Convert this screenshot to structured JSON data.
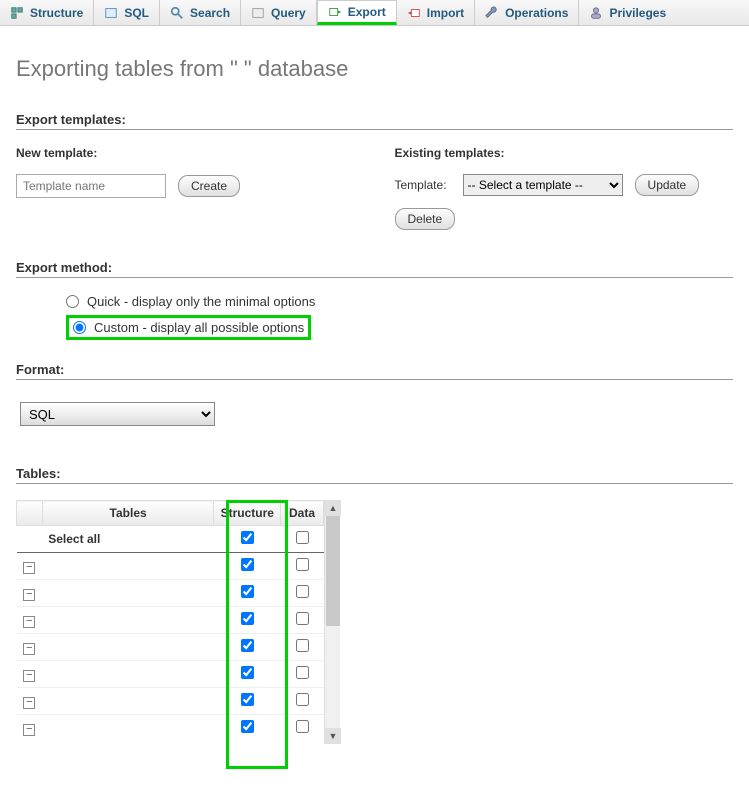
{
  "tabs": {
    "structure": "Structure",
    "sql": "SQL",
    "search": "Search",
    "query": "Query",
    "export": "Export",
    "import": "Import",
    "operations": "Operations",
    "privileges": "Privileges"
  },
  "heading": "Exporting tables from \"                    \" database",
  "sections": {
    "templates": "Export templates:",
    "method": "Export method:",
    "format": "Format:",
    "tables": "Tables:"
  },
  "templates": {
    "new_label": "New template:",
    "existing_label": "Existing templates:",
    "name_placeholder": "Template name",
    "create": "Create",
    "template_word": "Template:",
    "select_option": "-- Select a template --",
    "update": "Update",
    "delete": "Delete"
  },
  "method": {
    "quick": "Quick - display only the minimal options",
    "custom": "Custom - display all possible options"
  },
  "format_value": "SQL",
  "tables_table": {
    "col_tables": "Tables",
    "col_structure": "Structure",
    "col_data": "Data",
    "select_all": "Select all",
    "rows": [
      {
        "name": "",
        "structure": true,
        "data": false
      },
      {
        "name": "",
        "structure": true,
        "data": false
      },
      {
        "name": "",
        "structure": true,
        "data": false
      },
      {
        "name": "",
        "structure": true,
        "data": false
      },
      {
        "name": "",
        "structure": true,
        "data": false
      },
      {
        "name": "",
        "structure": true,
        "data": false
      },
      {
        "name": "",
        "structure": true,
        "data": false
      }
    ]
  }
}
